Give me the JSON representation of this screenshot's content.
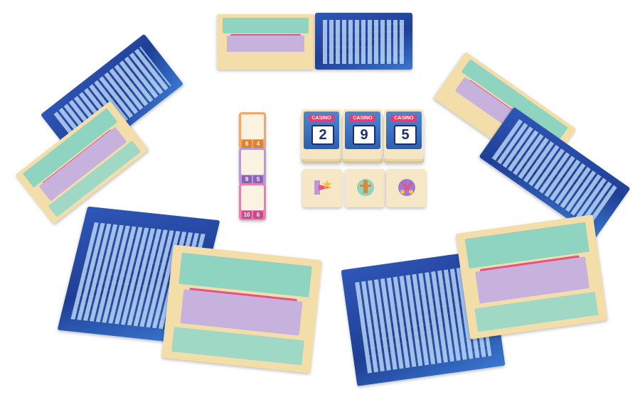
{
  "scene": "Board game components laid out on a white table",
  "colors": {
    "board_blue": "#2a4fae",
    "board_tan": "#f3deaa",
    "teal": "#8fd3c1",
    "lavender": "#c7b2de",
    "pink": "#e8508a",
    "card_cream": "#f6e8c6"
  },
  "draw_decks": [
    {
      "sign": "CASINO",
      "number": "2"
    },
    {
      "sign": "CASINO",
      "number": "9"
    },
    {
      "sign": "CASINO",
      "number": "5"
    }
  ],
  "action_cards": [
    {
      "icon": "star-arrow-icon"
    },
    {
      "icon": "robot-figure-icon"
    },
    {
      "icon": "scissors-icon"
    }
  ],
  "plan_cards": [
    {
      "color": "#f3a66a",
      "values": [
        "8",
        "4"
      ]
    },
    {
      "color": "#b79ad6",
      "values": [
        "9",
        "5"
      ]
    },
    {
      "color": "#e680b0",
      "values": [
        "10",
        "6"
      ]
    }
  ]
}
